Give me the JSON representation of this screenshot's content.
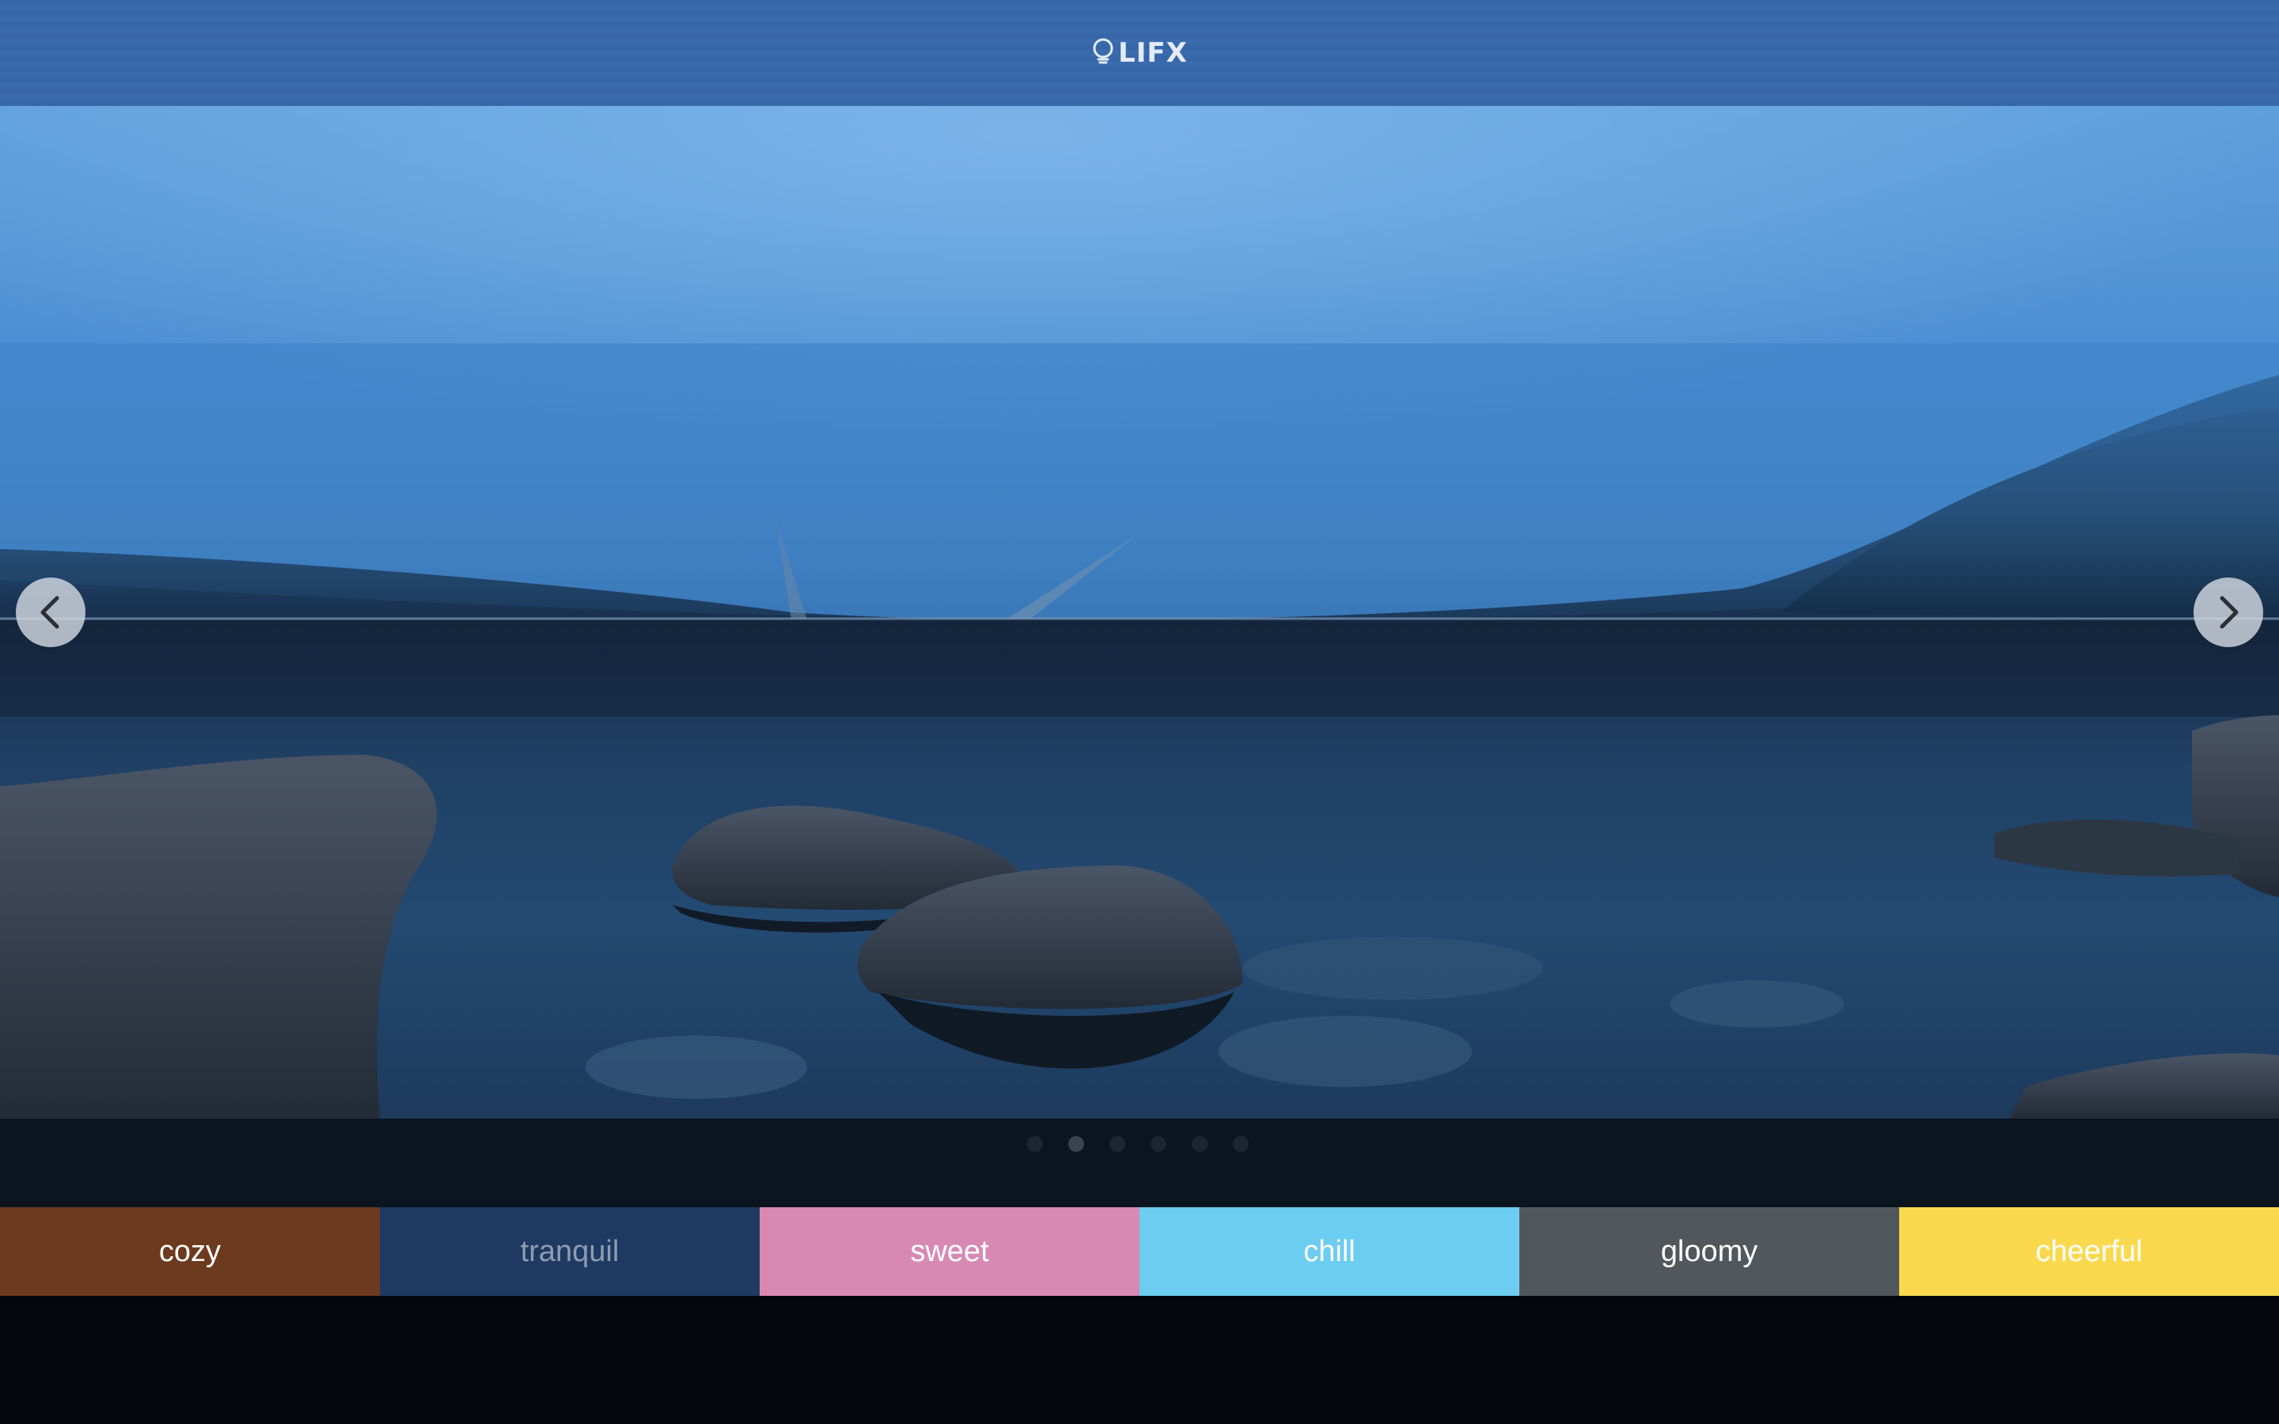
{
  "header": {
    "brand": "LIFX",
    "background": "#3767a8"
  },
  "hero": {
    "scene": "misty mountain lake at dusk with rocks"
  },
  "carousel": {
    "slide_count": 6,
    "active_index": 1
  },
  "moods": [
    {
      "label": "cozy",
      "color": "#6e3a1f"
    },
    {
      "label": "tranquil",
      "color": "#1e3a63"
    },
    {
      "label": "sweet",
      "color": "#d789b4"
    },
    {
      "label": "chill",
      "color": "#6ccdf0"
    },
    {
      "label": "gloomy",
      "color": "#52575c"
    },
    {
      "label": "cheerful",
      "color": "#fbd94f"
    }
  ],
  "selected_mood": "tranquil",
  "icons": {
    "logo": "bulb-icon",
    "prev": "chevron-left-icon",
    "next": "chevron-right-icon"
  }
}
